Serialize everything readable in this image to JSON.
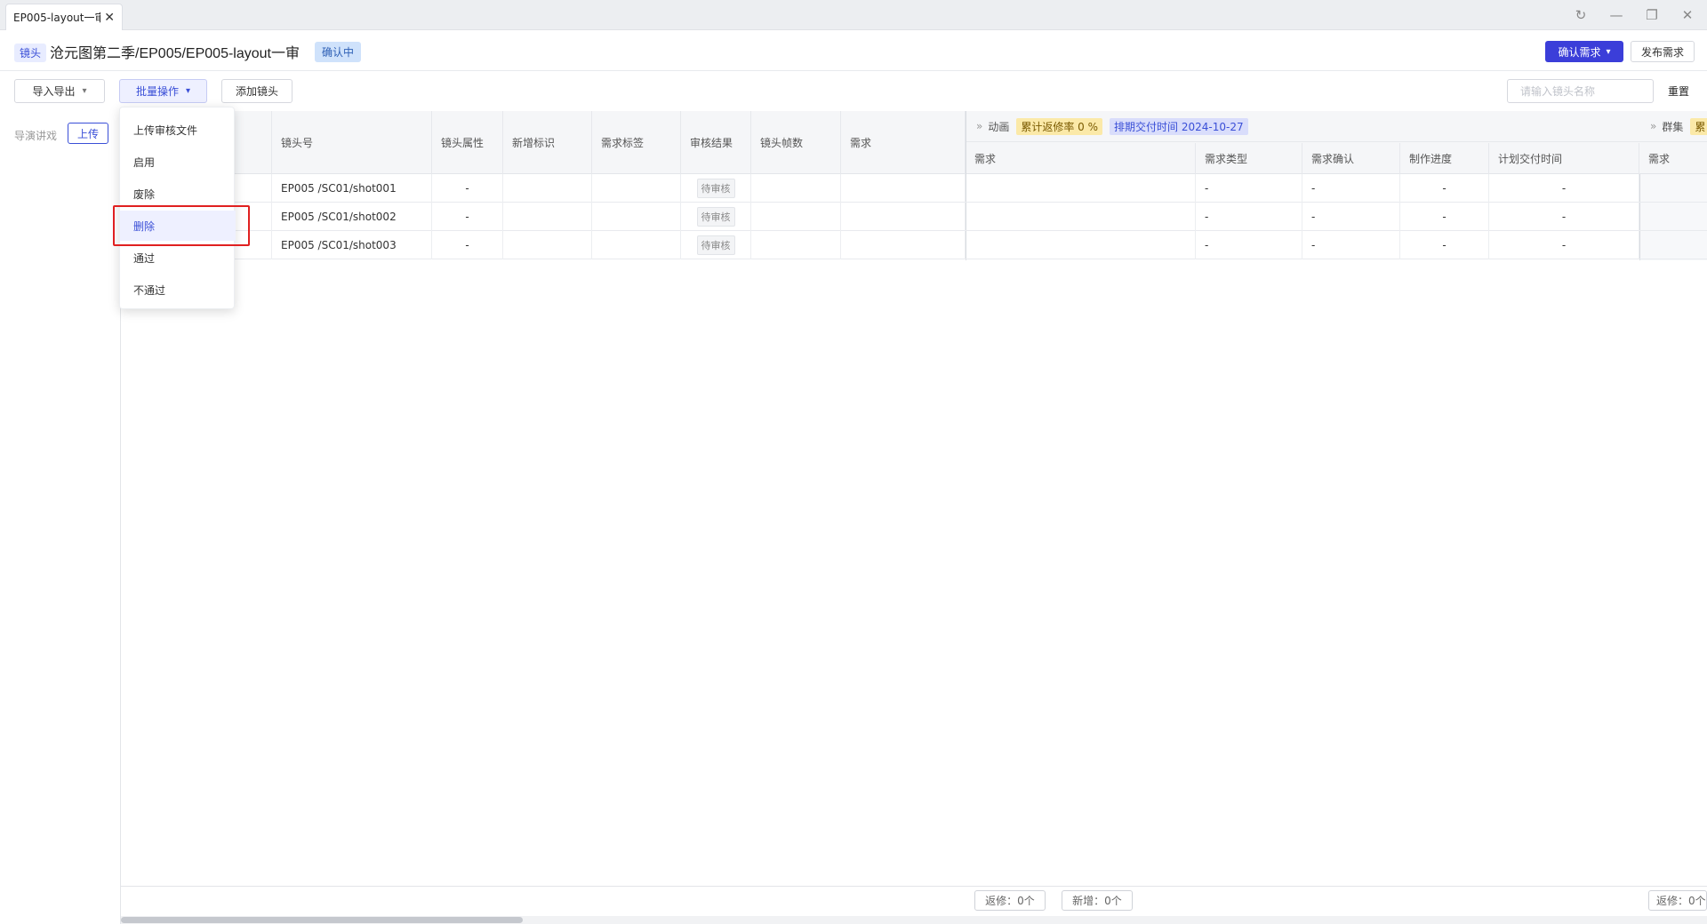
{
  "window": {
    "tab_label": "EP005-layout一审",
    "close_glyph": "✕",
    "controls": {
      "refresh": "↻",
      "minimize": "—",
      "restore": "❐",
      "close": "✕"
    }
  },
  "header": {
    "shot_tag": "镜头",
    "title": "沧元图第二季/EP005/EP005-layout一审",
    "status": "确认中",
    "confirm_button": "确认需求",
    "publish_button": "发布需求"
  },
  "toolbar": {
    "import_export": "导入导出",
    "batch_ops": "批量操作",
    "add_shot": "添加镜头",
    "search_placeholder": "请输入镜头名称",
    "reset": "重置"
  },
  "left_panel": {
    "label": "导演讲戏",
    "upload": "上传"
  },
  "dropdown": {
    "items": [
      "上传审核文件",
      "启用",
      "废除",
      "删除",
      "通过",
      "不通过"
    ],
    "highlighted": "删除"
  },
  "table": {
    "columns": [
      "镜头号",
      "镜头属性",
      "新增标识",
      "需求标签",
      "审核结果",
      "镜头帧数",
      "需求"
    ],
    "group_animation": {
      "name": "动画",
      "rework_rate": "累计返修率 0 %",
      "delivery": "排期交付时间 2024-10-27",
      "subcolumns": [
        "需求",
        "需求类型",
        "需求确认",
        "制作进度",
        "计划交付时间"
      ]
    },
    "group_crowd": {
      "name": "群集",
      "pill": "累",
      "subcolumns": [
        "需求"
      ]
    },
    "rows": [
      {
        "shot": "EP005 /SC01/shot001",
        "attr": "-",
        "result": "待审核",
        "type": "-",
        "confirm": "-",
        "progress": "-",
        "plan": "-"
      },
      {
        "shot": "EP005 /SC01/shot002",
        "attr": "-",
        "result": "待审核",
        "type": "-",
        "confirm": "-",
        "progress": "-",
        "plan": "-"
      },
      {
        "shot": "EP005 /SC01/shot003",
        "attr": "-",
        "result": "待审核",
        "type": "-",
        "confirm": "-",
        "progress": "-",
        "plan": "-"
      }
    ],
    "footer": {
      "rework": "返修：0个",
      "added": "新增：0个",
      "rework2": "返修：0个"
    }
  },
  "colors": {
    "accent": "#3b3ed9",
    "highlight": "#e02020"
  }
}
